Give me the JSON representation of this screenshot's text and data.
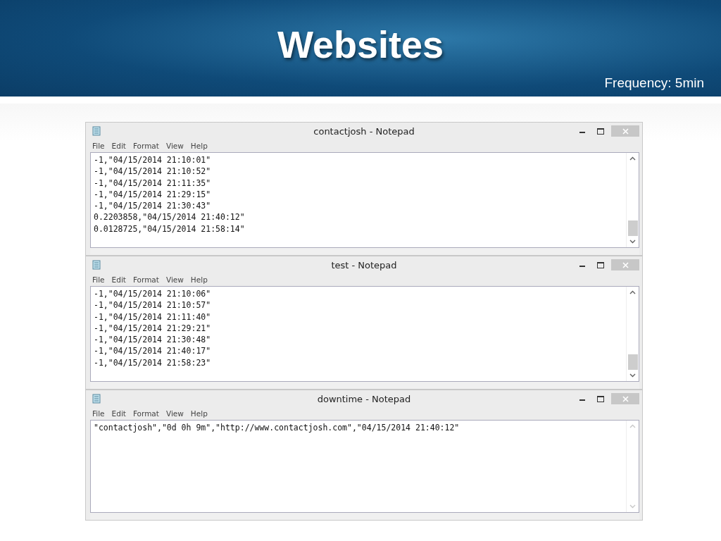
{
  "slide": {
    "title": "Websites",
    "subtitle": "Frequency: 5min"
  },
  "windows": [
    {
      "title": "contactjosh - Notepad",
      "menu": [
        "File",
        "Edit",
        "Format",
        "View",
        "Help"
      ],
      "scrollbar_disabled": false,
      "lines": [
        "-1,\"04/15/2014 21:10:01\"",
        "-1,\"04/15/2014 21:10:52\"",
        "-1,\"04/15/2014 21:11:35\"",
        "-1,\"04/15/2014 21:29:15\"",
        "-1,\"04/15/2014 21:30:43\"",
        "0.2203858,\"04/15/2014 21:40:12\"",
        "0.0128725,\"04/15/2014 21:58:14\""
      ]
    },
    {
      "title": "test - Notepad",
      "menu": [
        "File",
        "Edit",
        "Format",
        "View",
        "Help"
      ],
      "scrollbar_disabled": false,
      "lines": [
        "-1,\"04/15/2014 21:10:06\"",
        "-1,\"04/15/2014 21:10:57\"",
        "-1,\"04/15/2014 21:11:40\"",
        "-1,\"04/15/2014 21:29:21\"",
        "-1,\"04/15/2014 21:30:48\"",
        "-1,\"04/15/2014 21:40:17\"",
        "-1,\"04/15/2014 21:58:23\""
      ]
    },
    {
      "title": "downtime - Notepad",
      "menu": [
        "File",
        "Edit",
        "Format",
        "View",
        "Help"
      ],
      "scrollbar_disabled": true,
      "lines": [
        "\"contactjosh\",\"0d 0h 9m\",\"http://www.contactjosh.com\",\"04/15/2014 21:40:12\""
      ]
    }
  ]
}
